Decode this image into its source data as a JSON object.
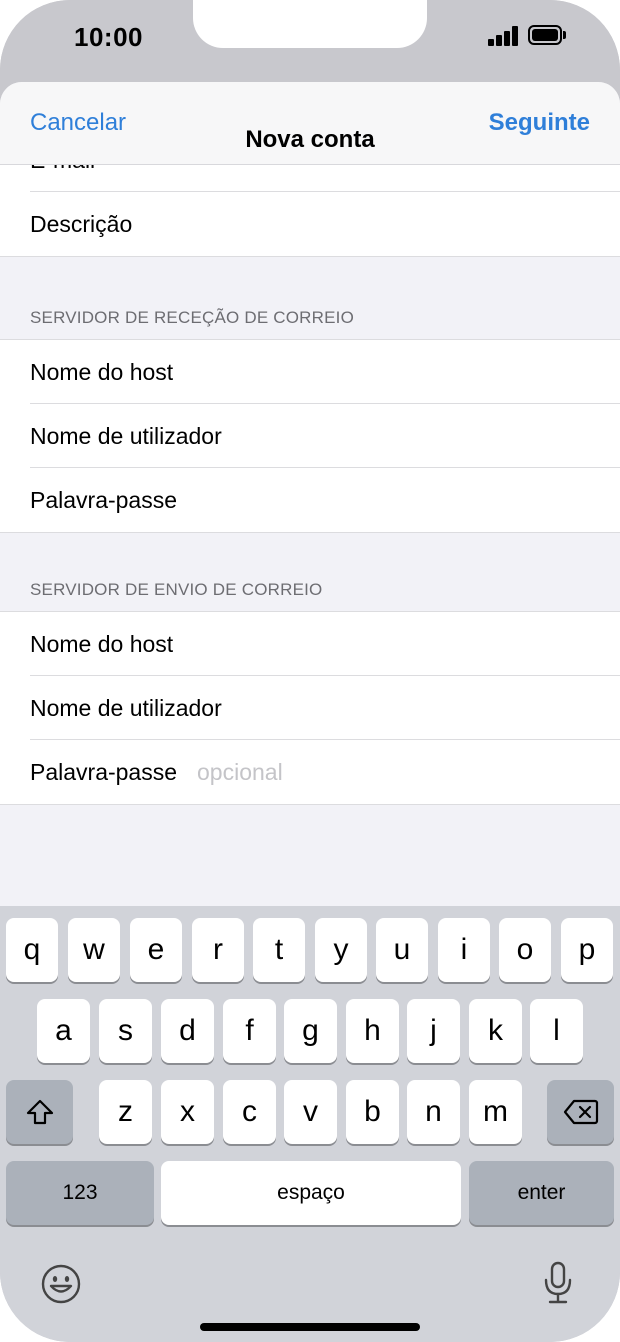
{
  "status_bar": {
    "time": "10:00"
  },
  "nav": {
    "cancel": "Cancelar",
    "title": "Nova conta",
    "next": "Seguinte"
  },
  "top_group": {
    "email_label_partial": "E-mail",
    "description_label": "Descrição"
  },
  "incoming": {
    "header": "SERVIDOR DE RECEÇÃO DE CORREIO",
    "rows": [
      {
        "label": "Nome do host"
      },
      {
        "label": "Nome de utilizador"
      },
      {
        "label": "Palavra-passe"
      }
    ]
  },
  "outgoing": {
    "header": "SERVIDOR DE ENVIO DE CORREIO",
    "rows": [
      {
        "label": "Nome do host"
      },
      {
        "label": "Nome de utilizador"
      },
      {
        "label": "Palavra-passe",
        "placeholder": "opcional"
      }
    ]
  },
  "keyboard": {
    "row1": [
      "q",
      "w",
      "e",
      "r",
      "t",
      "y",
      "u",
      "i",
      "o",
      "p"
    ],
    "row2": [
      "a",
      "s",
      "d",
      "f",
      "g",
      "h",
      "j",
      "k",
      "l"
    ],
    "row3": [
      "z",
      "x",
      "c",
      "v",
      "b",
      "n",
      "m"
    ],
    "numbers_key": "123",
    "space_key": "espaço",
    "enter_key": "enter",
    "icons": [
      "shift-icon",
      "delete-icon",
      "emoji-icon",
      "microphone-icon"
    ]
  },
  "colors": {
    "accent": "#2f7fd9",
    "keyboard_bg": "#d1d3d9",
    "dark_key": "#abb1ba",
    "grouped_bg": "#f2f2f7"
  }
}
